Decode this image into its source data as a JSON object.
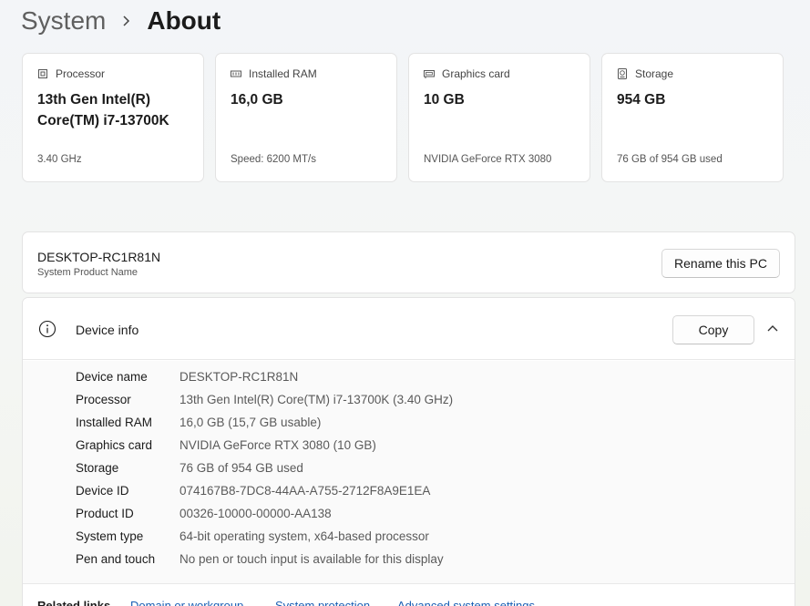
{
  "breadcrumb": {
    "parent": "System",
    "current": "About"
  },
  "specs": [
    {
      "icon": "processor-icon",
      "label": "Processor",
      "value": "13th Gen Intel(R) Core(TM) i7-13700K",
      "sub": "3.40 GHz"
    },
    {
      "icon": "ram-icon",
      "label": "Installed RAM",
      "value": "16,0 GB",
      "sub": "Speed: 6200 MT/s"
    },
    {
      "icon": "graphics-card-icon",
      "label": "Graphics card",
      "value": "10 GB",
      "sub": "NVIDIA GeForce RTX 3080"
    },
    {
      "icon": "storage-icon",
      "label": "Storage",
      "value": "954 GB",
      "sub": "76 GB of 954 GB used"
    }
  ],
  "pc": {
    "name": "DESKTOP-RC1R81N",
    "sub": "System Product Name",
    "rename_label": "Rename this PC"
  },
  "device_info": {
    "title": "Device info",
    "copy_label": "Copy",
    "rows": [
      {
        "label": "Device name",
        "value": "DESKTOP-RC1R81N"
      },
      {
        "label": "Processor",
        "value": "13th Gen Intel(R) Core(TM) i7-13700K (3.40 GHz)"
      },
      {
        "label": "Installed RAM",
        "value": "16,0 GB (15,7 GB usable)"
      },
      {
        "label": "Graphics card",
        "value": "NVIDIA GeForce RTX 3080 (10 GB)"
      },
      {
        "label": "Storage",
        "value": "76 GB of 954 GB used"
      },
      {
        "label": "Device ID",
        "value": "074167B8-7DC8-44AA-A755-2712F8A9E1EA"
      },
      {
        "label": "Product ID",
        "value": "00326-10000-00000-AA138"
      },
      {
        "label": "System type",
        "value": "64-bit operating system, x64-based processor"
      },
      {
        "label": "Pen and touch",
        "value": "No pen or touch input is available for this display"
      }
    ]
  },
  "related": {
    "label": "Related links",
    "links": [
      "Domain or workgroup",
      "System protection",
      "Advanced system settings"
    ]
  },
  "colors": {
    "link": "#1a5fb4",
    "card_bg": "#ffffff",
    "border": "#e3e3e3"
  }
}
